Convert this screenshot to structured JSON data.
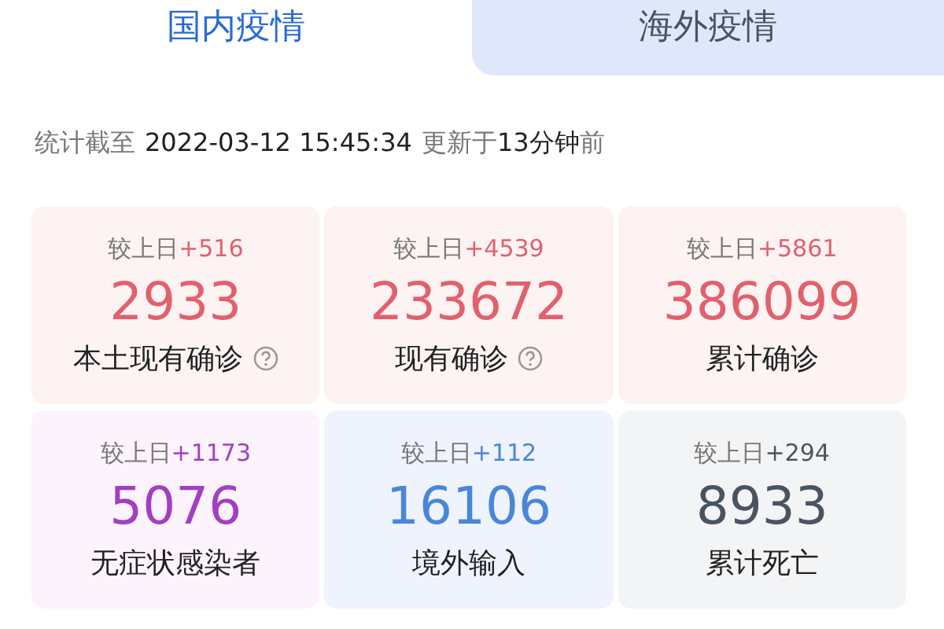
{
  "tabs": [
    {
      "label": "国内疫情",
      "selected": true
    },
    {
      "label": "海外疫情",
      "selected": false
    }
  ],
  "update": {
    "prefix": "统计截至",
    "time": "2022-03-12 15:45:34",
    "ago_prefix": "更新于",
    "ago": "13分钟",
    "ago_suffix": "前"
  },
  "cards": [
    {
      "delta_label": "较上日",
      "delta": "+516",
      "value": "2933",
      "label": "本土现有确诊",
      "help": true,
      "color": "#e2606c"
    },
    {
      "delta_label": "较上日",
      "delta": "+4539",
      "value": "233672",
      "label": "现有确诊",
      "help": true,
      "color": "#e2606c"
    },
    {
      "delta_label": "较上日",
      "delta": "+5861",
      "value": "386099",
      "label": "累计确诊",
      "help": false,
      "color": "#e2606c"
    },
    {
      "delta_label": "较上日",
      "delta": "+1173",
      "value": "5076",
      "label": "无症状感染者",
      "help": false,
      "color": "#a23fc0"
    },
    {
      "delta_label": "较上日",
      "delta": "+112",
      "value": "16106",
      "label": "境外输入",
      "help": false,
      "color": "#4a86d8"
    },
    {
      "delta_label": "较上日",
      "delta": "+294",
      "value": "8933",
      "label": "累计死亡",
      "help": false,
      "color": "#4a5461"
    }
  ]
}
